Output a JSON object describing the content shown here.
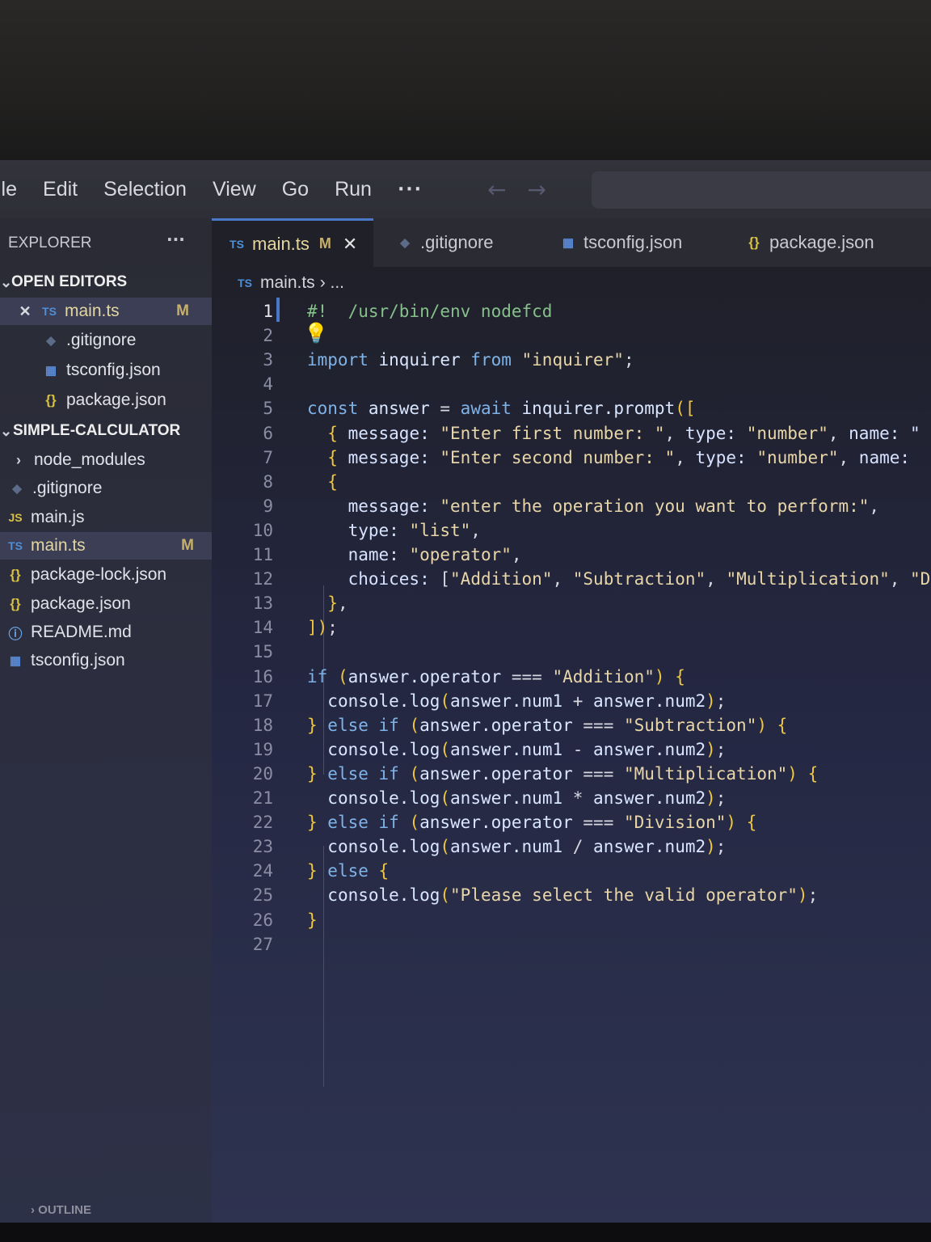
{
  "menu": {
    "items": [
      "ile",
      "Edit",
      "Selection",
      "View",
      "Go",
      "Run"
    ],
    "more": "···",
    "back_icon": "arrow-left-icon",
    "forward_icon": "arrow-right-icon"
  },
  "explorer": {
    "title": "EXPLORER",
    "dots": "···",
    "open_editors_label": "OPEN EDITORS",
    "open_editors": [
      {
        "name": "main.ts",
        "icon": "ts-file-icon",
        "badge": "M",
        "close": "✕"
      },
      {
        "name": ".gitignore",
        "icon": "git-file-icon"
      },
      {
        "name": "tsconfig.json",
        "icon": "tsconfig-file-icon"
      },
      {
        "name": "package.json",
        "icon": "json-file-icon"
      }
    ],
    "project_label": "SIMPLE-CALCULATOR",
    "files": [
      {
        "name": "node_modules",
        "icon": "chevron-right-icon"
      },
      {
        "name": ".gitignore",
        "icon": "git-file-icon"
      },
      {
        "name": "main.js",
        "icon": "js-file-icon"
      },
      {
        "name": "main.ts",
        "icon": "ts-file-icon",
        "badge": "M"
      },
      {
        "name": "package-lock.json",
        "icon": "json-file-icon"
      },
      {
        "name": "package.json",
        "icon": "json-file-icon"
      },
      {
        "name": "README.md",
        "icon": "info-icon"
      },
      {
        "name": "tsconfig.json",
        "icon": "tsconfig-file-icon"
      }
    ],
    "outline_label": "OUTLINE"
  },
  "tabs": [
    {
      "label": "main.ts",
      "icon": "ts-file-icon",
      "badge": "M",
      "close": "✕"
    },
    {
      "label": ".gitignore",
      "icon": "git-file-icon"
    },
    {
      "label": "tsconfig.json",
      "icon": "tsconfig-file-icon"
    },
    {
      "label": "package.json",
      "icon": "json-file-icon"
    }
  ],
  "breadcrumb": {
    "file": "main.ts",
    "rest": "› ..."
  },
  "colors": {
    "keyword": "#7fb3e8",
    "identifier": "#d9e6ff",
    "string": "#e8d6a8",
    "comment": "#86c08a",
    "property": "#d7e3ff",
    "bracket": "#f0c840",
    "punct": "#d8d8e0",
    "line_number": "#8a8da3",
    "accent": "#4a78c8",
    "modified": "#c7b16a"
  },
  "code": [
    [
      [
        "comment",
        "#!  /usr/bin/env nodefcd"
      ]
    ],
    [],
    [
      [
        "keyword",
        "import"
      ],
      [
        "identifier",
        " inquirer "
      ],
      [
        "keyword",
        "from"
      ],
      [
        "string",
        " \"inquirer\""
      ],
      [
        "punct",
        ";"
      ]
    ],
    [],
    [
      [
        "keyword",
        "const"
      ],
      [
        "identifier",
        " answer"
      ],
      [
        "punct",
        " = "
      ],
      [
        "keyword",
        "await"
      ],
      [
        "identifier",
        " inquirer.prompt"
      ],
      [
        "bracket",
        "(["
      ]
    ],
    [
      [
        "punct",
        "  "
      ],
      [
        "bracket",
        "{"
      ],
      [
        "property",
        " message: "
      ],
      [
        "string",
        "\"Enter first number: \""
      ],
      [
        "punct",
        ", "
      ],
      [
        "property",
        "type: "
      ],
      [
        "string",
        "\"number\""
      ],
      [
        "punct",
        ", "
      ],
      [
        "property",
        "name: \""
      ]
    ],
    [
      [
        "punct",
        "  "
      ],
      [
        "bracket",
        "{"
      ],
      [
        "property",
        " message: "
      ],
      [
        "string",
        "\"Enter second number: \""
      ],
      [
        "punct",
        ", "
      ],
      [
        "property",
        "type: "
      ],
      [
        "string",
        "\"number\""
      ],
      [
        "punct",
        ", "
      ],
      [
        "property",
        "name:"
      ]
    ],
    [
      [
        "punct",
        "  "
      ],
      [
        "bracket",
        "{"
      ]
    ],
    [
      [
        "punct",
        "    "
      ],
      [
        "property",
        "message: "
      ],
      [
        "string",
        "\"enter the operation you want to perform:\""
      ],
      [
        "punct",
        ","
      ]
    ],
    [
      [
        "punct",
        "    "
      ],
      [
        "property",
        "type: "
      ],
      [
        "string",
        "\"list\""
      ],
      [
        "punct",
        ","
      ]
    ],
    [
      [
        "punct",
        "    "
      ],
      [
        "property",
        "name: "
      ],
      [
        "string",
        "\"operator\""
      ],
      [
        "punct",
        ","
      ]
    ],
    [
      [
        "punct",
        "    "
      ],
      [
        "property",
        "choices: "
      ],
      [
        "punct",
        "["
      ],
      [
        "string",
        "\"Addition\""
      ],
      [
        "punct",
        ", "
      ],
      [
        "string",
        "\"Subtraction\""
      ],
      [
        "punct",
        ", "
      ],
      [
        "string",
        "\"Multiplication\""
      ],
      [
        "punct",
        ", "
      ],
      [
        "string",
        "\"D"
      ]
    ],
    [
      [
        "punct",
        "  "
      ],
      [
        "bracket",
        "}"
      ],
      [
        "punct",
        ","
      ]
    ],
    [
      [
        "bracket",
        "])"
      ],
      [
        "punct",
        ";"
      ]
    ],
    [],
    [
      [
        "keyword",
        "if"
      ],
      [
        "bracket",
        " ("
      ],
      [
        "identifier",
        "answer.operator"
      ],
      [
        "punct",
        " === "
      ],
      [
        "string",
        "\"Addition\""
      ],
      [
        "bracket",
        ") {"
      ]
    ],
    [
      [
        "punct",
        "  "
      ],
      [
        "identifier",
        "console.log"
      ],
      [
        "bracket",
        "("
      ],
      [
        "identifier",
        "answer.num1"
      ],
      [
        "punct",
        " + "
      ],
      [
        "identifier",
        "answer.num2"
      ],
      [
        "bracket",
        ")"
      ],
      [
        "punct",
        ";"
      ]
    ],
    [
      [
        "bracket",
        "}"
      ],
      [
        "keyword",
        " else if"
      ],
      [
        "bracket",
        " ("
      ],
      [
        "identifier",
        "answer.operator"
      ],
      [
        "punct",
        " === "
      ],
      [
        "string",
        "\"Subtraction\""
      ],
      [
        "bracket",
        ") {"
      ]
    ],
    [
      [
        "punct",
        "  "
      ],
      [
        "identifier",
        "console.log"
      ],
      [
        "bracket",
        "("
      ],
      [
        "identifier",
        "answer.num1"
      ],
      [
        "punct",
        " - "
      ],
      [
        "identifier",
        "answer.num2"
      ],
      [
        "bracket",
        ")"
      ],
      [
        "punct",
        ";"
      ]
    ],
    [
      [
        "bracket",
        "}"
      ],
      [
        "keyword",
        " else if"
      ],
      [
        "bracket",
        " ("
      ],
      [
        "identifier",
        "answer.operator"
      ],
      [
        "punct",
        " === "
      ],
      [
        "string",
        "\"Multiplication\""
      ],
      [
        "bracket",
        ") {"
      ]
    ],
    [
      [
        "punct",
        "  "
      ],
      [
        "identifier",
        "console.log"
      ],
      [
        "bracket",
        "("
      ],
      [
        "identifier",
        "answer.num1"
      ],
      [
        "punct",
        " * "
      ],
      [
        "identifier",
        "answer.num2"
      ],
      [
        "bracket",
        ")"
      ],
      [
        "punct",
        ";"
      ]
    ],
    [
      [
        "bracket",
        "}"
      ],
      [
        "keyword",
        " else if"
      ],
      [
        "bracket",
        " ("
      ],
      [
        "identifier",
        "answer.operator"
      ],
      [
        "punct",
        " === "
      ],
      [
        "string",
        "\"Division\""
      ],
      [
        "bracket",
        ") {"
      ]
    ],
    [
      [
        "punct",
        "  "
      ],
      [
        "identifier",
        "console.log"
      ],
      [
        "bracket",
        "("
      ],
      [
        "identifier",
        "answer.num1"
      ],
      [
        "punct",
        " / "
      ],
      [
        "identifier",
        "answer.num2"
      ],
      [
        "bracket",
        ")"
      ],
      [
        "punct",
        ";"
      ]
    ],
    [
      [
        "bracket",
        "}"
      ],
      [
        "keyword",
        " else"
      ],
      [
        "bracket",
        " {"
      ]
    ],
    [
      [
        "punct",
        "  "
      ],
      [
        "identifier",
        "console.log"
      ],
      [
        "bracket",
        "("
      ],
      [
        "string",
        "\"Please select the valid operator\""
      ],
      [
        "bracket",
        ")"
      ],
      [
        "punct",
        ";"
      ]
    ],
    [
      [
        "bracket",
        "}"
      ]
    ],
    []
  ]
}
